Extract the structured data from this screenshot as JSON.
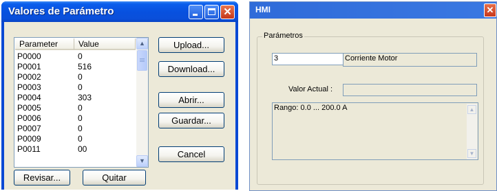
{
  "param_window": {
    "title": "Valores de Parámetro",
    "columns": [
      "Parameter",
      "Value"
    ],
    "rows": [
      {
        "parameter": "P0000",
        "value": "0"
      },
      {
        "parameter": "P0001",
        "value": "516"
      },
      {
        "parameter": "P0002",
        "value": "0"
      },
      {
        "parameter": "P0003",
        "value": "0"
      },
      {
        "parameter": "P0004",
        "value": "303"
      },
      {
        "parameter": "P0005",
        "value": "0"
      },
      {
        "parameter": "P0006",
        "value": "0"
      },
      {
        "parameter": "P0007",
        "value": "0"
      },
      {
        "parameter": "P0009",
        "value": "0"
      },
      {
        "parameter": "P0011",
        "value": "00"
      }
    ],
    "buttons": {
      "upload": "Upload...",
      "download": "Download...",
      "abrir": "Abrir...",
      "guardar": "Guardar...",
      "cancel": "Cancel",
      "revisar": "Revisar...",
      "quitar": "Quitar"
    },
    "icons": [
      "minimize-icon",
      "maximize-icon",
      "close-icon",
      "scroll-up-icon",
      "scroll-down-icon"
    ]
  },
  "hmi_window": {
    "title": "HMI",
    "group_label": "Parámetros",
    "param_number": "3",
    "param_name": "Corriente Motor",
    "valor_actual_label": "Valor Actual :",
    "valor_actual": "",
    "range_text": "Rango: 0.0 ... 200.0 A",
    "icons": [
      "close-icon",
      "spin-up-icon",
      "spin-down-icon"
    ]
  },
  "colors": {
    "xp_titlebar": "#0b5eec",
    "dialog_bg": "#ece9d8",
    "close_red": "#c5371a"
  }
}
